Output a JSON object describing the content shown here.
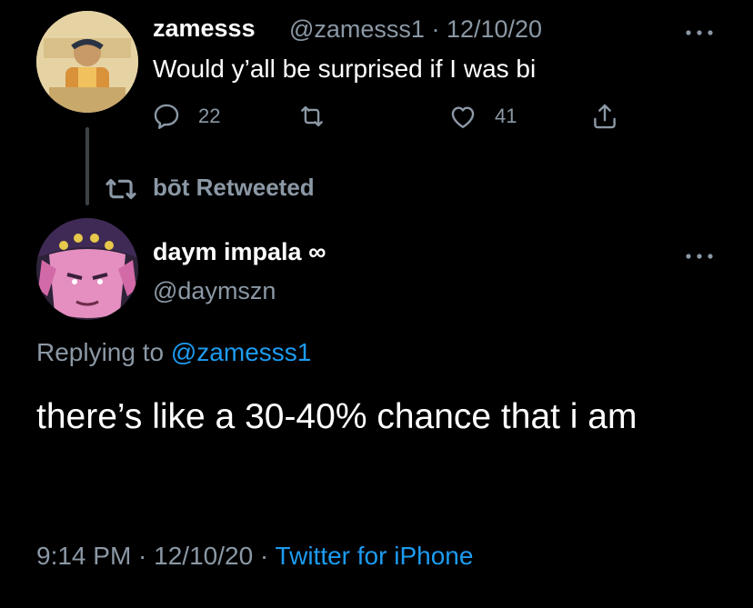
{
  "parent_tweet": {
    "display_name": "zamesss",
    "handle_date": "@zamesss1 · 12/10/20",
    "text": "Would y’all be surprised if I was bi",
    "reply_count": "22",
    "retweet_count": "",
    "like_count": "41",
    "avatar_icon": "avatar-image",
    "more_icon": "more-icon",
    "reply_icon": "reply-icon",
    "retweet_icon": "retweet-icon",
    "like_icon": "heart-icon",
    "share_icon": "share-icon"
  },
  "retweet_banner": {
    "text": "bōt Retweeted",
    "icon": "retweet-icon"
  },
  "main_tweet": {
    "display_name": "daym impala ∞",
    "handle": "@daymszn",
    "replying_prefix": "Replying to",
    "replying_to": "@zamesss1",
    "text": "there’s like a 30-40% chance that i am",
    "timestamp": "9:14 PM · 12/10/20 ·",
    "source": "Twitter for iPhone",
    "avatar_icon": "avatar-image",
    "more_icon": "more-icon"
  },
  "colors": {
    "background": "#000000",
    "text": "#ffffff",
    "secondary": "#8b98a5",
    "link": "#1d9bf0"
  }
}
